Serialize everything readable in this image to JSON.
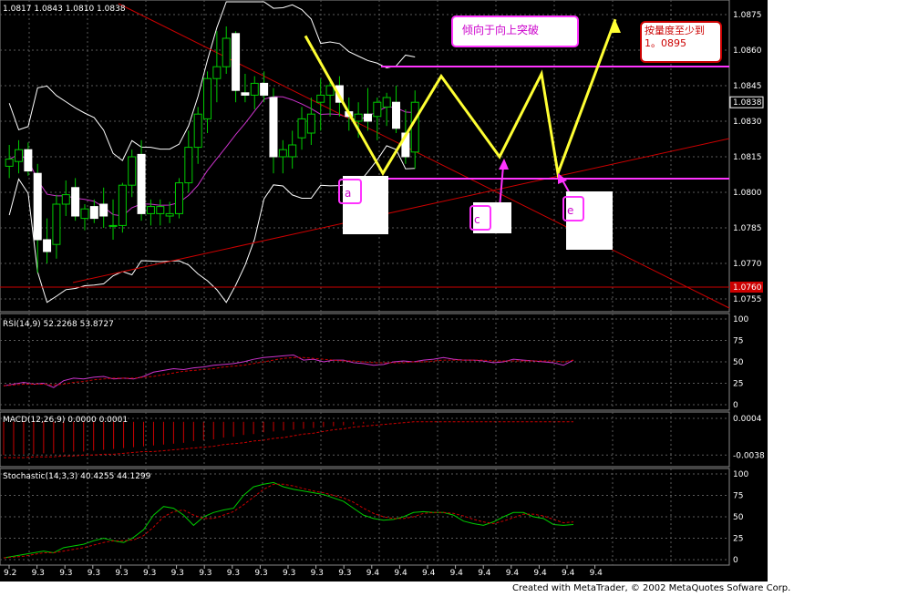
{
  "app": "MetaTrader",
  "credit": "Created with MetaTrader, © 2002 MetaQuotes Sofware Corp.",
  "colors": {
    "background": "#000000",
    "grid": "#5a5a5a",
    "bull_candle": "#ffffff",
    "wick": "#00cc00",
    "bollinger": "#ffffff",
    "trendline": "#cc0000",
    "annotation_pattern": "#ffff33",
    "annotation_magenta": "#ff33ff",
    "rsi_line": "#cc33cc",
    "macd_bars": "#cc0000",
    "stochastic_main": "#00cc00",
    "stochastic_signal": "#cc0000"
  },
  "chart_data": [
    {
      "type": "candlestick",
      "header": "1.0817 1.0843 1.0810 1.0838",
      "ylim": [
        1.075,
        1.088
      ],
      "y_ticks": [
        "1.0875",
        "1.0860",
        "1.0845",
        "1.0830",
        "1.0815",
        "1.0800",
        "1.0785",
        "1.0770",
        "1.0755"
      ],
      "y_tick_values": [
        1.0875,
        1.086,
        1.0845,
        1.083,
        1.0815,
        1.08,
        1.0785,
        1.077,
        1.0755
      ],
      "last_price_label": "1.0838",
      "last_price": 1.0838,
      "support_label": "1.0760",
      "support_price": 1.076,
      "x_ticks": [
        "9.2",
        "9.3",
        "9.3",
        "9.3",
        "9.3",
        "9.3",
        "9.3",
        "9.3",
        "9.3",
        "9.3",
        "9.3",
        "9.3",
        "9.3",
        "9.4",
        "9.4",
        "9.4",
        "9.4",
        "9.4",
        "9.4",
        "9.4",
        "9.4",
        "9.4"
      ],
      "candles": [
        [
          1.0811,
          1.082,
          1.0806,
          1.0814
        ],
        [
          1.0813,
          1.0822,
          1.0808,
          1.0818
        ],
        [
          1.0818,
          1.0821,
          1.0807,
          1.0809
        ],
        [
          1.0808,
          1.0812,
          1.0766,
          1.078
        ],
        [
          1.078,
          1.0789,
          1.077,
          1.0775
        ],
        [
          1.0778,
          1.0799,
          1.0772,
          1.0795
        ],
        [
          1.0795,
          1.0805,
          1.079,
          1.0799
        ],
        [
          1.0802,
          1.0806,
          1.0788,
          1.079
        ],
        [
          1.0789,
          1.0795,
          1.0784,
          1.0793
        ],
        [
          1.0794,
          1.0797,
          1.0787,
          1.0789
        ],
        [
          1.0795,
          1.0802,
          1.0785,
          1.079
        ],
        [
          1.0786,
          1.0797,
          1.078,
          1.0786
        ],
        [
          1.0786,
          1.0804,
          1.0783,
          1.0803
        ],
        [
          1.0803,
          1.0818,
          1.0798,
          1.0815
        ],
        [
          1.0816,
          1.0822,
          1.0788,
          1.0791
        ],
        [
          1.0791,
          1.0797,
          1.0786,
          1.0794
        ],
        [
          1.0791,
          1.0797,
          1.0786,
          1.0794
        ],
        [
          1.079,
          1.0796,
          1.0787,
          1.0791
        ],
        [
          1.0791,
          1.0806,
          1.0789,
          1.0804
        ],
        [
          1.0804,
          1.0826,
          1.08,
          1.0819
        ],
        [
          1.0819,
          1.0836,
          1.0812,
          1.0833
        ],
        [
          1.0831,
          1.0851,
          1.0825,
          1.0848
        ],
        [
          1.0848,
          1.0868,
          1.0838,
          1.0853
        ],
        [
          1.0853,
          1.087,
          1.085,
          1.0865
        ],
        [
          1.0867,
          1.0868,
          1.0838,
          1.0843
        ],
        [
          1.0842,
          1.085,
          1.0838,
          1.0841
        ],
        [
          1.0841,
          1.0849,
          1.0835,
          1.0846
        ],
        [
          1.0846,
          1.0851,
          1.0838,
          1.0841
        ],
        [
          1.084,
          1.0844,
          1.0808,
          1.0815
        ],
        [
          1.0815,
          1.0822,
          1.0808,
          1.0818
        ],
        [
          1.0815,
          1.0826,
          1.081,
          1.082
        ],
        [
          1.0823,
          1.0836,
          1.0818,
          1.0831
        ],
        [
          1.0825,
          1.084,
          1.082,
          1.0833
        ],
        [
          1.0838,
          1.0848,
          1.0826,
          1.0841
        ],
        [
          1.0841,
          1.0847,
          1.0832,
          1.0845
        ],
        [
          1.0845,
          1.0849,
          1.0832,
          1.0838
        ],
        [
          1.0834,
          1.084,
          1.0826,
          1.0832
        ],
        [
          1.083,
          1.0838,
          1.0823,
          1.0833
        ],
        [
          1.0833,
          1.0844,
          1.0826,
          1.083
        ],
        [
          1.0832,
          1.084,
          1.0822,
          1.0838
        ],
        [
          1.0836,
          1.0842,
          1.0828,
          1.084
        ],
        [
          1.0838,
          1.0845,
          1.0825,
          1.0827
        ],
        [
          1.0825,
          1.0835,
          1.0812,
          1.0815
        ],
        [
          1.0817,
          1.0843,
          1.081,
          1.0838
        ]
      ],
      "annotations": [
        {
          "label": "a",
          "kind": "pattern-point"
        },
        {
          "label": "c",
          "kind": "pattern-point"
        },
        {
          "label": "e",
          "kind": "pattern-point"
        },
        {
          "label": "倾向于向上突破",
          "kind": "callout"
        },
        {
          "label": "按量度至少到 1。0895",
          "kind": "callout"
        }
      ],
      "pattern_prices": [
        1.0866,
        1.0808,
        1.0849,
        1.0815,
        1.085,
        1.0808,
        1.0873
      ]
    },
    {
      "type": "line",
      "header": "RSI(14,9) 52.2268 53.8727",
      "ylim": [
        0,
        100
      ],
      "y_ticks": [
        "100",
        "75",
        "50",
        "25",
        "0"
      ],
      "y_tick_values": [
        100,
        75,
        50,
        25,
        0
      ],
      "series": [
        {
          "name": "RSI(14)",
          "values": [
            22,
            24,
            26,
            24,
            25,
            20,
            28,
            31,
            30,
            32,
            33,
            30,
            31,
            30,
            33,
            38,
            40,
            42,
            41,
            43,
            44,
            46,
            47,
            48,
            50,
            53,
            55,
            56,
            57,
            58,
            52,
            53,
            50,
            52,
            52,
            49,
            48,
            46,
            47,
            50,
            51,
            50,
            52,
            53,
            55,
            53,
            52,
            52,
            51,
            49,
            50,
            53,
            52,
            51,
            50,
            49,
            46,
            52
          ]
        },
        {
          "name": "MA(9)",
          "values": [
            22,
            23,
            24,
            24,
            24,
            23,
            24,
            26,
            27,
            29,
            30,
            31,
            31,
            31,
            32,
            33,
            35,
            37,
            39,
            40,
            41,
            42,
            44,
            45,
            46,
            48,
            50,
            52,
            54,
            55,
            55,
            54,
            53,
            52,
            51,
            51,
            50,
            49,
            49,
            49,
            49,
            50,
            50,
            51,
            52,
            52,
            52,
            52,
            52,
            51,
            51,
            51,
            51,
            51,
            51,
            51,
            50,
            52
          ]
        }
      ]
    },
    {
      "type": "bar",
      "header": "MACD(12,26,9) 0.0000 0.0001",
      "ylim": [
        -0.0045,
        0.0005
      ],
      "y_ticks": [
        "0.0004",
        "-0.0038"
      ],
      "y_tick_values": [
        0.0004,
        -0.0038
      ],
      "series": [
        {
          "name": "MACD",
          "values": [
            -0.0038,
            -0.0038,
            -0.0037,
            -0.0037,
            -0.0036,
            -0.0036,
            -0.0035,
            -0.0034,
            -0.0034,
            -0.0033,
            -0.0032,
            -0.0031,
            -0.003,
            -0.0029,
            -0.0028,
            -0.0027,
            -0.0026,
            -0.0025,
            -0.0024,
            -0.0022,
            -0.0021,
            -0.002,
            -0.0018,
            -0.0017,
            -0.0015,
            -0.0014,
            -0.0012,
            -0.0011,
            -0.001,
            -0.0009,
            -0.0008,
            -0.0007,
            -0.0006,
            -0.0005,
            -0.0004,
            -0.0003,
            -0.0002,
            -0.0001,
            0,
            0,
            0,
            0,
            0,
            0,
            0,
            0,
            0,
            0,
            0,
            0,
            0,
            0,
            0,
            0,
            0,
            0,
            0,
            0
          ]
        },
        {
          "name": "Signal",
          "values": [
            -0.0041,
            -0.0041,
            -0.0041,
            -0.004,
            -0.004,
            -0.004,
            -0.0039,
            -0.0039,
            -0.0038,
            -0.0038,
            -0.0037,
            -0.0037,
            -0.0036,
            -0.0035,
            -0.0034,
            -0.0034,
            -0.0033,
            -0.0032,
            -0.0031,
            -0.003,
            -0.0029,
            -0.0028,
            -0.0026,
            -0.0025,
            -0.0024,
            -0.0022,
            -0.0021,
            -0.0019,
            -0.0018,
            -0.0016,
            -0.0014,
            -0.0013,
            -0.0011,
            -0.0009,
            -0.0008,
            -0.0006,
            -0.0005,
            -0.0004,
            -0.0003,
            -0.0002,
            -0.0001,
            0,
            0,
            0,
            0,
            0,
            0,
            0,
            0,
            0,
            0,
            0,
            0,
            0,
            0,
            0,
            0,
            0
          ]
        }
      ]
    },
    {
      "type": "line",
      "header": "Stochastic(14,3,3) 40.4255 44.1299",
      "ylim": [
        0,
        100
      ],
      "y_ticks": [
        "100",
        "75",
        "50",
        "25",
        "0"
      ],
      "y_tick_values": [
        100,
        75,
        50,
        25,
        0
      ],
      "series": [
        {
          "name": "%K",
          "values": [
            2,
            4,
            6,
            8,
            10,
            8,
            14,
            16,
            18,
            22,
            25,
            22,
            20,
            26,
            35,
            52,
            62,
            60,
            52,
            40,
            50,
            55,
            58,
            60,
            75,
            85,
            88,
            90,
            85,
            82,
            80,
            78,
            76,
            72,
            68,
            60,
            52,
            48,
            46,
            47,
            50,
            55,
            56,
            55,
            55,
            52,
            45,
            42,
            40,
            44,
            50,
            55,
            55,
            50,
            48,
            41,
            40,
            41
          ]
        },
        {
          "name": "%D",
          "values": [
            2,
            3,
            4,
            6,
            8,
            8,
            10,
            12,
            14,
            17,
            20,
            22,
            22,
            23,
            28,
            38,
            50,
            56,
            58,
            52,
            48,
            48,
            52,
            56,
            64,
            73,
            82,
            88,
            88,
            86,
            83,
            80,
            78,
            75,
            72,
            67,
            60,
            54,
            50,
            48,
            48,
            50,
            54,
            55,
            55,
            54,
            51,
            47,
            44,
            42,
            45,
            49,
            53,
            53,
            51,
            47,
            43,
            44
          ]
        }
      ]
    }
  ]
}
